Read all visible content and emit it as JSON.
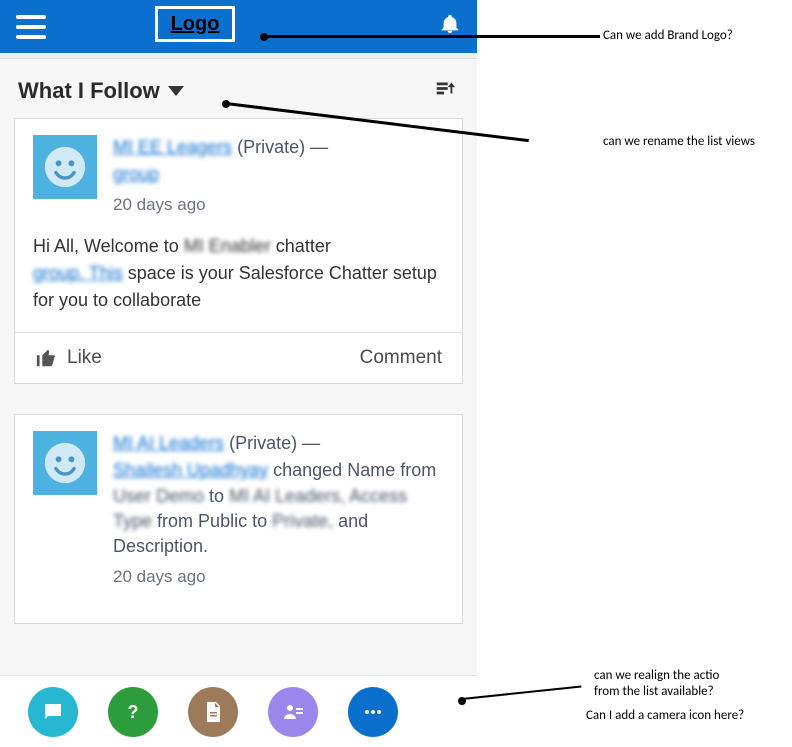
{
  "header": {
    "logo_text": "Logo"
  },
  "filter": {
    "label": "What I Follow"
  },
  "posts": [
    {
      "group_obscured": "MI EE Leagers",
      "privacy_suffix": "(Private) —",
      "line2_obscured": "group",
      "timestamp": "20 days ago",
      "body_prefix": "Hi All, Welcome to",
      "body_mid_obscured": "MI Enabler",
      "body_mid2": "chatter",
      "body_link_obscured": "group. This",
      "body_rest": "space is your Salesforce Chatter setup for you to collaborate"
    },
    {
      "group_obscured": "MI AI Leaders",
      "privacy_suffix": "(Private) —",
      "author_obscured": "Shailesh Upadhyay",
      "changed_text": "changed Name from",
      "changed_obs1": "User Demo",
      "changed_mid": "to",
      "changed_obs2": "MI AI Leaders, Access Type",
      "changed_rest": "from Public to",
      "changed_obs3": "Private,",
      "changed_last": "and Description.",
      "timestamp": "20 days ago"
    }
  ],
  "actions": {
    "like": "Like",
    "comment": "Comment"
  },
  "annotations": {
    "logo": "Can we add Brand Logo?",
    "listview": "can we rename the list views",
    "realign_line1": "can we realign the actio",
    "realign_line2": "from the list available?",
    "camera": "Can I add a camera icon here?"
  }
}
